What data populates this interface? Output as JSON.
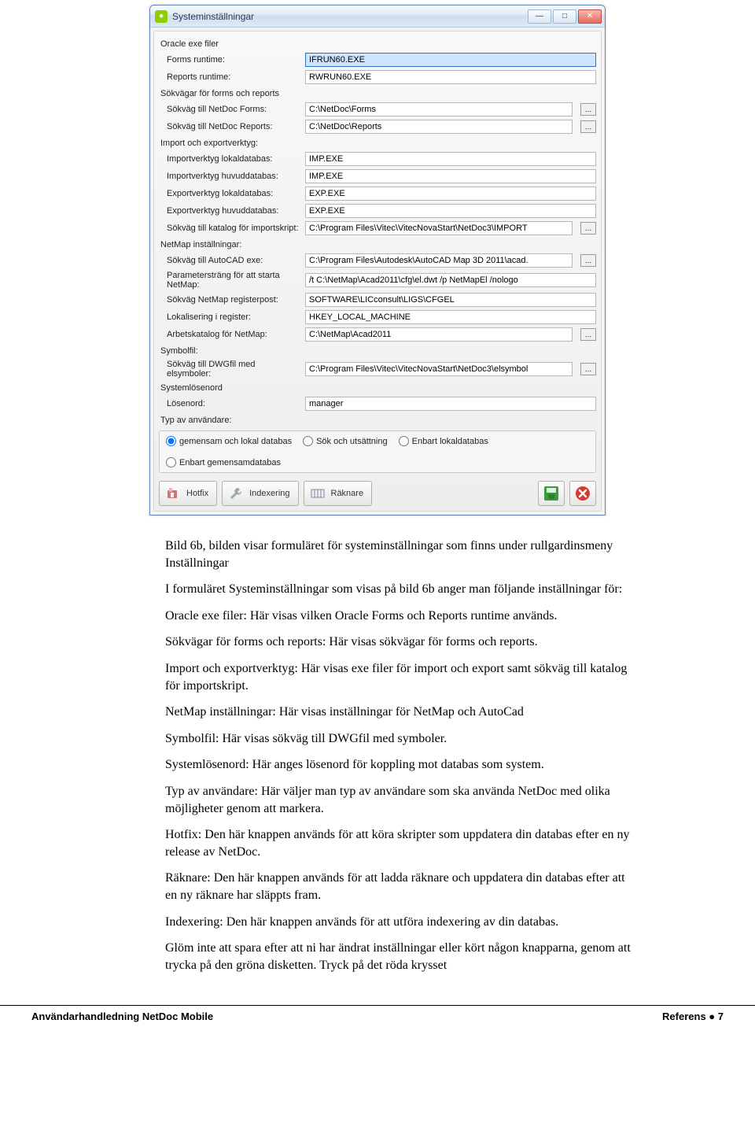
{
  "window": {
    "title": "Systeminställningar",
    "sections": {
      "oracle": {
        "header": "Oracle exe filer",
        "forms_label": "Forms runtime:",
        "forms_value": "IFRUN60.EXE",
        "reports_label": "Reports runtime:",
        "reports_value": "RWRUN60.EXE"
      },
      "paths": {
        "header": "Sökvägar för forms och reports",
        "forms_label": "Sökväg till NetDoc Forms:",
        "forms_value": "C:\\NetDoc\\Forms",
        "reports_label": "Sökväg till NetDoc Reports:",
        "reports_value": "C:\\NetDoc\\Reports"
      },
      "impexp": {
        "header": "Import och exportverktyg:",
        "imp_local_label": "Importverktyg lokaldatabas:",
        "imp_local_value": "IMP.EXE",
        "imp_main_label": "Importverktyg huvuddatabas:",
        "imp_main_value": "IMP.EXE",
        "exp_local_label": "Exportverktyg lokaldatabas:",
        "exp_local_value": "EXP.EXE",
        "exp_main_label": "Exportverktyg huvuddatabas:",
        "exp_main_value": "EXP.EXE",
        "script_label": "Sökväg till katalog för importskript:",
        "script_value": "C:\\Program Files\\Vitec\\VitecNovaStart\\NetDoc3\\IMPORT"
      },
      "netmap": {
        "header": "NetMap inställningar:",
        "autocad_label": "Sökväg till AutoCAD exe:",
        "autocad_value": "C:\\Program Files\\Autodesk\\AutoCAD Map 3D 2011\\acad.",
        "param_label": "Parametersträng för att starta NetMap:",
        "param_value": "/t C:\\NetMap\\Acad2011\\cfg\\el.dwt /p NetMapEl /nologo",
        "reg_label": "Sökväg NetMap registerpost:",
        "reg_value": "SOFTWARE\\LICconsult\\LIGS\\CFGEL",
        "loc_label": "Lokalisering i register:",
        "loc_value": "HKEY_LOCAL_MACHINE",
        "work_label": "Arbetskatalog för NetMap:",
        "work_value": "C:\\NetMap\\Acad2011"
      },
      "symbol": {
        "header": "Symbolfil:",
        "label": "Sökväg till DWGfil med elsymboler:",
        "value": "C:\\Program Files\\Vitec\\VitecNovaStart\\NetDoc3\\elsymbol"
      },
      "syspass": {
        "header": "Systemlösenord",
        "label": "Lösenord:",
        "value": "manager"
      },
      "usertype": {
        "header": "Typ av användare:",
        "opt1": "gemensam och lokal databas",
        "opt2": "Sök och utsättning",
        "opt3": "Enbart lokaldatabas",
        "opt4": "Enbart gemensamdatabas"
      }
    },
    "buttons": {
      "hotfix": "Hotfix",
      "indexing": "Indexering",
      "counters": "Räknare"
    }
  },
  "article": {
    "p1": "Bild 6b, bilden visar formuläret för systeminställningar som finns under rullgardinsmeny Inställningar",
    "p2": "I formuläret Systeminställningar som visas på bild 6b anger man följande inställningar för:",
    "p3": "Oracle exe filer: Här visas vilken Oracle Forms och Reports runtime används.",
    "p4": "Sökvägar för forms och reports:  Här visas sökvägar för forms och reports.",
    "p5": "Import och exportverktyg: Här visas exe filer för import och export samt sökväg till katalog för importskript.",
    "p6": "NetMap inställningar: Här visas inställningar för NetMap och AutoCad",
    "p7": "Symbolfil: Här visas sökväg till DWGfil med symboler.",
    "p8": "Systemlösenord: Här anges lösenord för koppling mot databas som system.",
    "p9": "Typ av användare: Här väljer man typ av användare som ska använda NetDoc med olika möjligheter genom att markera.",
    "p10": "Hotfix: Den här knappen används för att köra skripter som uppdatera din databas efter en ny release av NetDoc.",
    "p11": "Räknare: Den här knappen används för att ladda räknare och uppdatera din databas efter att en ny räknare har släppts fram.",
    "p12": "Indexering: Den här knappen används för att utföra indexering av din databas.",
    "p13": "Glöm inte att spara efter att ni har ändrat inställningar eller kört någon knapparna, genom att trycka på den gröna disketten. Tryck på det röda krysset"
  },
  "footer": {
    "left": "Användarhandledning NetDoc Mobile",
    "right_label": "Referens",
    "right_sep": " ● ",
    "right_page": "7"
  }
}
